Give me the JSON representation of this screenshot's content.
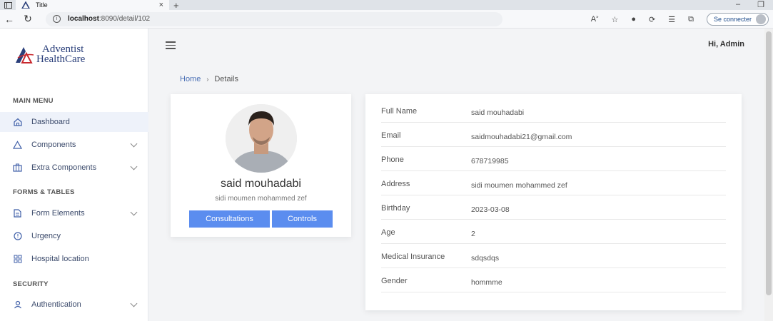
{
  "browser": {
    "tab_title": "Title",
    "url_host": "localhost",
    "url_path": ":8090/detail/102",
    "signin_label": "Se connecter"
  },
  "brand": {
    "line1": "Adventist",
    "line2": "HealthCare"
  },
  "header": {
    "greeting": "Hi, Admin"
  },
  "sidebar": {
    "sections": [
      "MAIN MENU",
      "FORMS & TABLES",
      "SECURITY"
    ],
    "items": [
      {
        "label": "Dashboard"
      },
      {
        "label": "Components"
      },
      {
        "label": "Extra Components"
      },
      {
        "label": "Form Elements"
      },
      {
        "label": "Urgency"
      },
      {
        "label": "Hospital location"
      },
      {
        "label": "Authentication"
      }
    ]
  },
  "breadcrumb": {
    "home": "Home",
    "current": "Details"
  },
  "profile": {
    "name": "said mouhadabi",
    "address": "sidi moumen mohammed zef",
    "buttons": [
      "Consultations",
      "Controls"
    ]
  },
  "details": {
    "rows": [
      {
        "label": "Full Name",
        "value": "said mouhadabi"
      },
      {
        "label": "Email",
        "value": "saidmouhadabi21@gmail.com"
      },
      {
        "label": "Phone",
        "value": "678719985"
      },
      {
        "label": "Address",
        "value": "sidi moumen mohammed zef"
      },
      {
        "label": "Birthday",
        "value": "2023-03-08"
      },
      {
        "label": "Age",
        "value": "2"
      },
      {
        "label": "Medical Insurance",
        "value": "sdqsdqs"
      },
      {
        "label": "Gender",
        "value": "hommme"
      }
    ]
  },
  "colors": {
    "accent": "#5b8def",
    "brand": "#2a3f7a",
    "icon": "#3f5fa8"
  }
}
